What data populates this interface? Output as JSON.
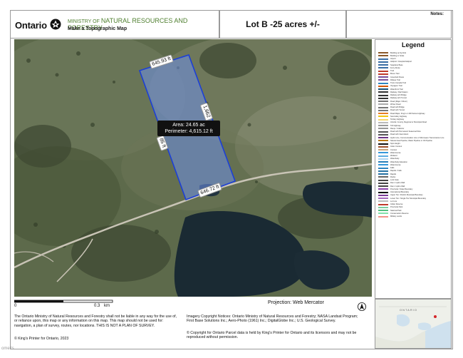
{
  "header": {
    "logo_word": "Ontario",
    "ministry_prefix": "MINISTRY OF",
    "ministry_name": "NATURAL RESOURCES AND FORESTRY",
    "subtitle": "Make a Topographic Map",
    "map_title": "Lot B -25 acres +/-",
    "notes_label": "Notes:"
  },
  "parcel": {
    "area_label": "Area: 24.65 ac",
    "perimeter_label": "Perimeter: 4,615.12 ft",
    "edge_top": "645.93 ft",
    "edge_right": "1,662",
    "edge_left": "85 ft",
    "edge_bottom": "646.72 ft",
    "fill_color": "#6d8fe8",
    "stroke_color": "#1c3fd6"
  },
  "legend": {
    "title": "Legend",
    "items": [
      "Building as Symbol",
      "Building to Scale",
      "Airport",
      "Heliport / Hospital Heliport",
      "Seaplane Base",
      "Ferry Route",
      "Trail",
      "Bruce Trail",
      "Greenbelt Route",
      "Rideau Trail",
      "Trans Canada Trail",
      "Voyageur Trail",
      "Waterfront Trail",
      "Railway / Rail Station",
      "Railway with Bridge",
      "Railway with Tunnel",
      "Road (Major / Minor)",
      "Winter Road",
      "Road with Bridge",
      "Road with Tunnel",
      "Road Major, King's or 400 Series Highway",
      "Secondary Highway",
      "Tertiary Highway",
      "Arterial, County, Regional or Municipal Road",
      "Toll Highway",
      "Ramp / Collector",
      "Road with Permanent Seasonal Flow",
      "Road with Intermittent",
      "Hydro Line, Communication Line or Microwave Transmission Line",
      "Natural Gas Pipeline, Water Pipeline or Oil Pipeline",
      "Spot Height",
      "Index Contour",
      "Contour",
      "Watercourse",
      "Wetland",
      "Waterbody",
      "Waterbody Elevation",
      "Watercourse",
      "Falls",
      "Rapids / Falls",
      "Rapids",
      "Rocks",
      "Lock Gate",
      "Dam / Hydro Wall",
      "Dam / Hydro Wall",
      "Provincial / State Boundary",
      "International Boundary",
      "Upper Tier / District Municipal Boundary",
      "Lower Tier / Single Tier Municipal Boundary",
      "Lot Line",
      "Indian Reserve",
      "Provincial Park",
      "National Park",
      "Conservation Reserve",
      "Military Lands"
    ]
  },
  "scale": {
    "left_label": "0",
    "right_label": "0.3",
    "unit": "km"
  },
  "projection": "Projection: Web Mercator",
  "north_label": "N",
  "disclaimer": "The Ontario Ministry of Natural Resources and Forestry shall not be liable in any way for the use of, or reliance upon, this map or any information on this map.  This map should not be used for: navigation, a plan of survey, routes, nor locations. THIS IS NOT A PLAN OF SURVEY.",
  "kings_printer": "© King's Printer for Ontario, 2023",
  "imagery_notice": "Imagery Copyright Notices: Ontario Ministry of Natural Resources and Forestry; NASA Landsat Program; First Base Solutions Inc.; Aero-Photo (1961) Inc.; DigitalGlobe Inc.; U.S. Geological Survey.",
  "parcel_copyright": "© Copyright for Ontario Parcel data is held by King's Printer for Ontario and its licensors and may not be reproduced without permission.",
  "inset_label": "ONTARIO",
  "watermark": "omelts",
  "colors": {
    "ministry_green": "#4f7f2f",
    "forest_dark": "#3f4a33",
    "water": "#1a2a33",
    "road": "#c9c4b6"
  }
}
